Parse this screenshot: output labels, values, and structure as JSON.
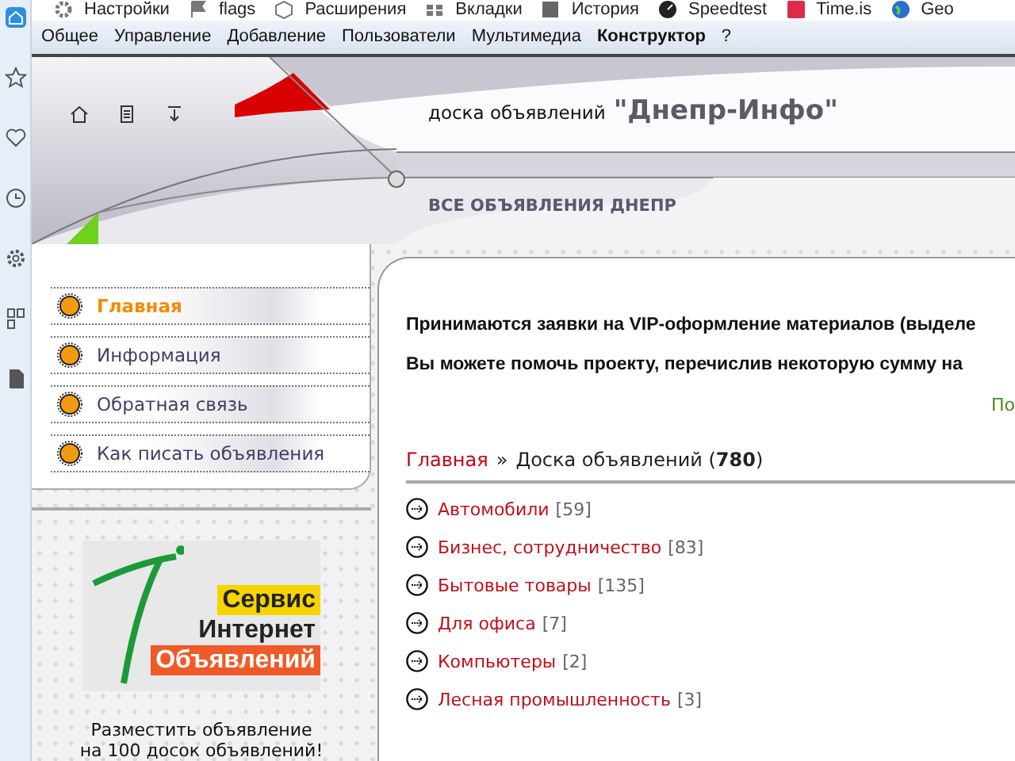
{
  "bookmarks": [
    {
      "label": "Настройки"
    },
    {
      "label": "flags"
    },
    {
      "label": "Расширения"
    },
    {
      "label": "Вкладки"
    },
    {
      "label": "История"
    },
    {
      "label": "Speedtest"
    },
    {
      "label": "Time.is"
    },
    {
      "label": "Geo"
    }
  ],
  "menu": [
    {
      "label": "Общее",
      "bold": false
    },
    {
      "label": "Управление",
      "bold": false
    },
    {
      "label": "Добавление",
      "bold": false
    },
    {
      "label": "Пользователи",
      "bold": false
    },
    {
      "label": "Мультимедиа",
      "bold": false
    },
    {
      "label": "Конструктор",
      "bold": true
    },
    {
      "label": "?",
      "bold": false
    }
  ],
  "header": {
    "subtitle": "доска объявлений",
    "title": "\"Днепр-Инфо\"",
    "tagline": "ВСЕ ОБЪЯВЛЕНИЯ ДНЕПР"
  },
  "nav": [
    {
      "label": "Главная",
      "selected": true
    },
    {
      "label": "Информация",
      "selected": false
    },
    {
      "label": "Обратная связь",
      "selected": false
    },
    {
      "label": "Как писать объявления",
      "selected": false
    }
  ],
  "banner": {
    "lines": [
      "Сервис",
      "Интернет",
      "Объявлений"
    ],
    "caption": "Разместить объявление\nна 100 досок объявлений!"
  },
  "notices": [
    "Принимаются заявки на VIP-оформление материалов (выделе",
    "Вы можете помочь проекту, перечислив некоторую сумму на"
  ],
  "notice_link": "По",
  "breadcrumb": {
    "home": "Главная",
    "separator": "»",
    "current": "Доска объявлений (**780**)"
  },
  "categories": [
    {
      "name": "Автомобили",
      "count": "[59]"
    },
    {
      "name": "Бизнес, сотрудничество",
      "count": "[83]"
    },
    {
      "name": "Бытовые товары",
      "count": "[135]"
    },
    {
      "name": "Для офиса",
      "count": "[7]"
    },
    {
      "name": "Компьютеры",
      "count": "[2]"
    },
    {
      "name": "Лесная промышленность",
      "count": "[3]"
    }
  ]
}
